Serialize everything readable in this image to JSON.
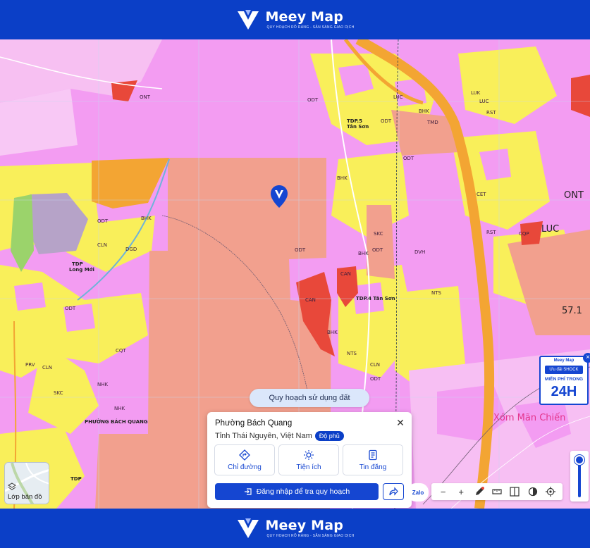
{
  "brand": {
    "name": "Meey Map",
    "tagline": "QUY HOẠCH RÕ RÀNG - SẴN SÀNG GIAO DỊCH"
  },
  "map": {
    "labels": {
      "ont1": "ONT",
      "luc1": "LUC",
      "luc2": "LUC",
      "ont_big": "ONT",
      "luc_big": "LUC",
      "odt1": "ODT",
      "odt2": "ODT",
      "odt3": "ODT",
      "odt4": "ODT",
      "odt5": "ODT",
      "odt6": "ODT",
      "odt7": "ODT",
      "odt8": "ODT",
      "bhk1": "BHK",
      "bhk2": "BHK",
      "bhk3": "BHK",
      "bhk4": "BHK",
      "cln1": "CLN",
      "cln2": "CLN",
      "cln3": "CLN",
      "dgd": "DGD",
      "skc": "SKC",
      "can1": "CAN",
      "can2": "CAN",
      "tdp5": "TDP.5",
      "tanson": "Tân Sơn",
      "tdp4": "TDP.4 Tân Sơn",
      "tdp_longmoi": "TDP",
      "longmoi": "Long Mới",
      "nts1": "NTS",
      "nts2": "NTS",
      "dvh": "DVH",
      "rst1": "RST",
      "rst2": "RST",
      "cqp": "CQP",
      "tmd": "TMD",
      "cet": "CET",
      "lux": "LUK",
      "ward": "PHƯỜNG BÁCH QUANG",
      "tdp_caubai": "TDP",
      "val57": "57.1",
      "xom": "Xóm Mãn Chiến",
      "prv": "PRV",
      "skc2": "SKC",
      "nhk1": "NHK",
      "nhk2": "NHK",
      "cqt": "CQT"
    }
  },
  "landuse_pill": "Quy hoạch sử dụng đất",
  "card": {
    "ward": "Phường Bách Quang",
    "province": "Tỉnh Thái Nguyên, Việt Nam",
    "coverage_badge": "Độ phủ",
    "actions": [
      {
        "label": "Chỉ đường"
      },
      {
        "label": "Tiện ích"
      },
      {
        "label": "Tin đăng"
      }
    ],
    "login": "Đăng nhập để tra quy hoạch"
  },
  "layers": {
    "label": "Lớp bản đồ"
  },
  "ad": {
    "brand": "Meey Map",
    "promo": "Ưu đãi SHOCK",
    "line": "MIỄN PHÍ TRONG",
    "hours": "24H"
  },
  "zalo": "Zalo",
  "toolbar": {
    "minus": "−",
    "plus": "+"
  },
  "colors": {
    "brand_blue": "#0b3fc7",
    "land_pink": "#f39cf2",
    "land_salmon": "#f2a08e",
    "land_yellow": "#f9ef5a",
    "land_red": "#e8483a",
    "road_orange": "#f3a533"
  }
}
